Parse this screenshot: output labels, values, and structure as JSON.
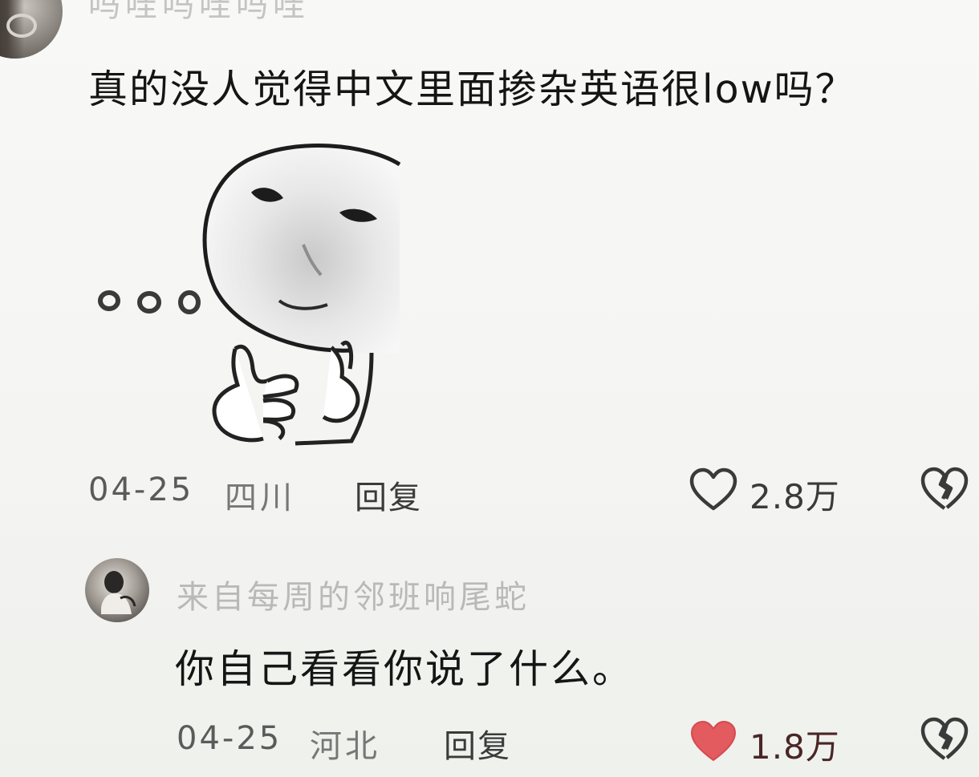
{
  "top_comment": {
    "username": "吗哇吗哇吗哇",
    "text": "真的没人觉得中文里面掺杂英语很low吗？",
    "date": "04-25",
    "location": "四川",
    "reply_label": "回复",
    "likes": "2.8万",
    "liked": false
  },
  "reply_comment": {
    "username": "来自每周的邻班响尾蛇",
    "text": "你自己看看你说了什么。",
    "date": "04-25",
    "location": "河北",
    "reply_label": "回复",
    "likes": "1.8万",
    "liked": true
  },
  "colors": {
    "like_active": "#e35a5f",
    "icon_stroke": "#3a3a3a"
  },
  "icons": {
    "like": "heart-icon",
    "dislike": "broken-heart-icon"
  }
}
